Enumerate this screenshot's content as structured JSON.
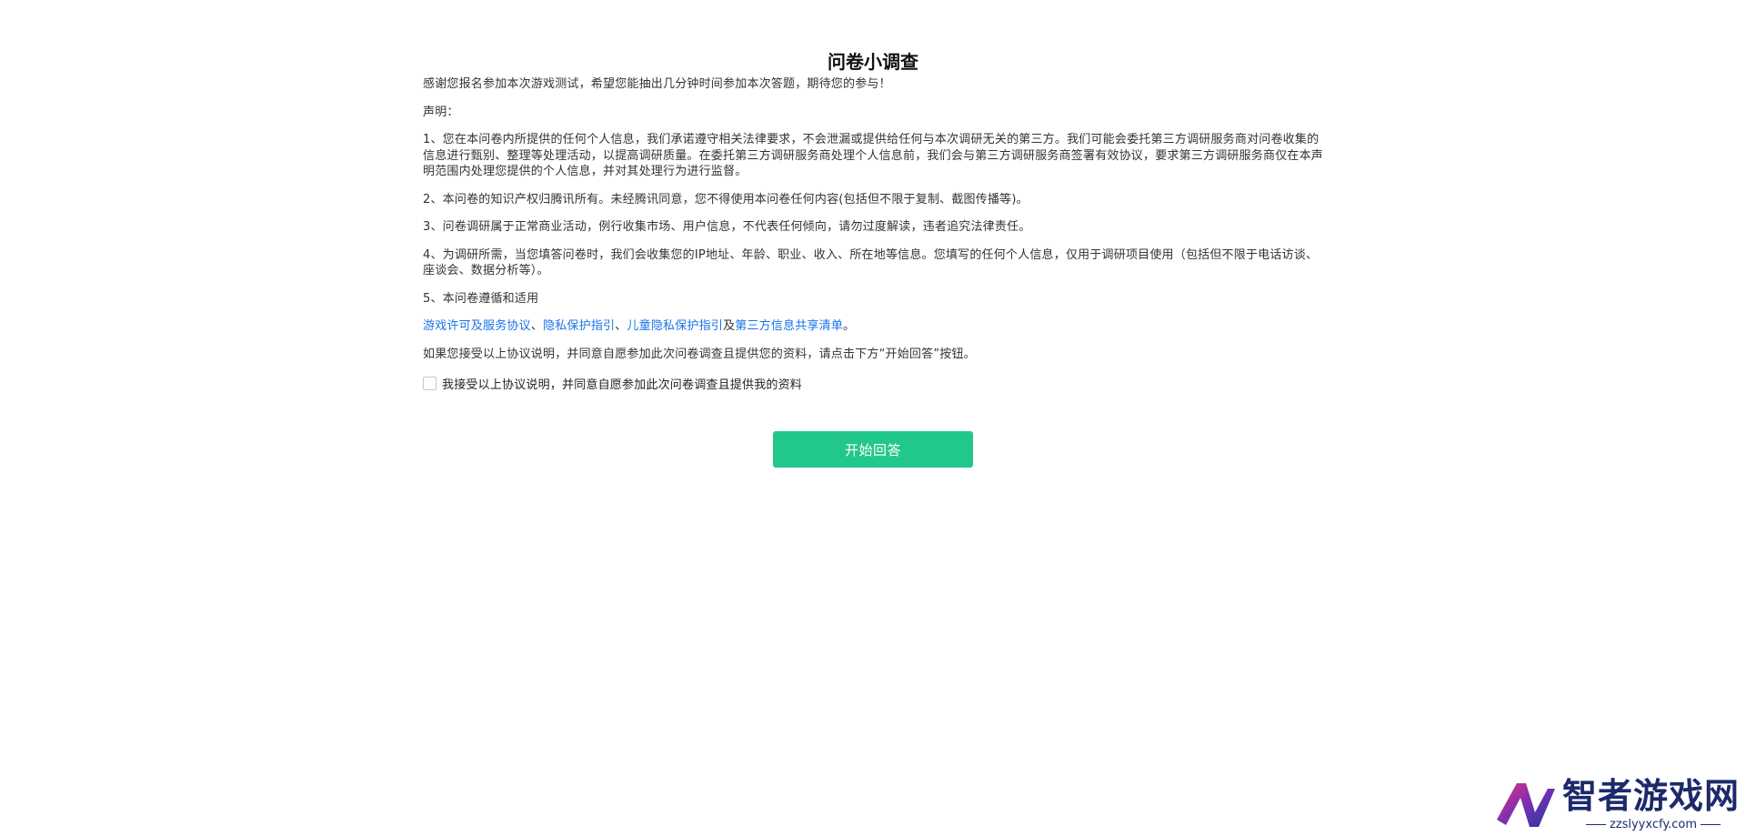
{
  "survey": {
    "title": "问卷小调查",
    "intro": "感谢您报名参加本次游戏测试，希望您能抽出几分钟时间参加本次答题，期待您的参与！",
    "statement_label": "声明：",
    "items": [
      "1、您在本问卷内所提供的任何个人信息，我们承诺遵守相关法律要求，不会泄漏或提供给任何与本次调研无关的第三方。我们可能会委托第三方调研服务商对问卷收集的信息进行甄别、整理等处理活动，以提高调研质量。在委托第三方调研服务商处理个人信息前，我们会与第三方调研服务商签署有效协议，要求第三方调研服务商仅在本声明范围内处理您提供的个人信息，并对其处理行为进行监督。",
      "2、本问卷的知识产权归腾讯所有。未经腾讯同意，您不得使用本问卷任何内容(包括但不限于复制、截图传播等)。",
      "3、问卷调研属于正常商业活动，例行收集市场、用户信息，不代表任何倾向，请勿过度解读，违者追究法律责任。",
      "4、为调研所需，当您填答问卷时，我们会收集您的IP地址、年龄、职业、收入、所在地等信息。您填写的任何个人信息，仅用于调研项目使用（包括但不限于电话访谈、座谈会、数据分析等）。",
      "5、本问卷遵循和适用"
    ],
    "links": {
      "link1": "游戏许可及服务协议",
      "sep1": "、",
      "link2": "隐私保护指引",
      "sep2": "、",
      "link3": "儿童隐私保护指引",
      "sep3": "及",
      "link4": "第三方信息共享清单",
      "end": "。"
    },
    "accept_note": "如果您接受以上协议说明，并同意自愿参加此次问卷调查且提供您的资料，请点击下方“开始回答”按钮。",
    "checkbox_label": "我接受以上协议说明，并同意自愿参加此次问卷调查且提供我的资料",
    "start_button": "开始回答"
  },
  "watermark": {
    "name": "智者游戏网",
    "url": "zzslyyxcfy.com"
  },
  "colors": {
    "button": "#22c78a",
    "link": "#1a73e8",
    "watermark": "#1c2a6b"
  }
}
